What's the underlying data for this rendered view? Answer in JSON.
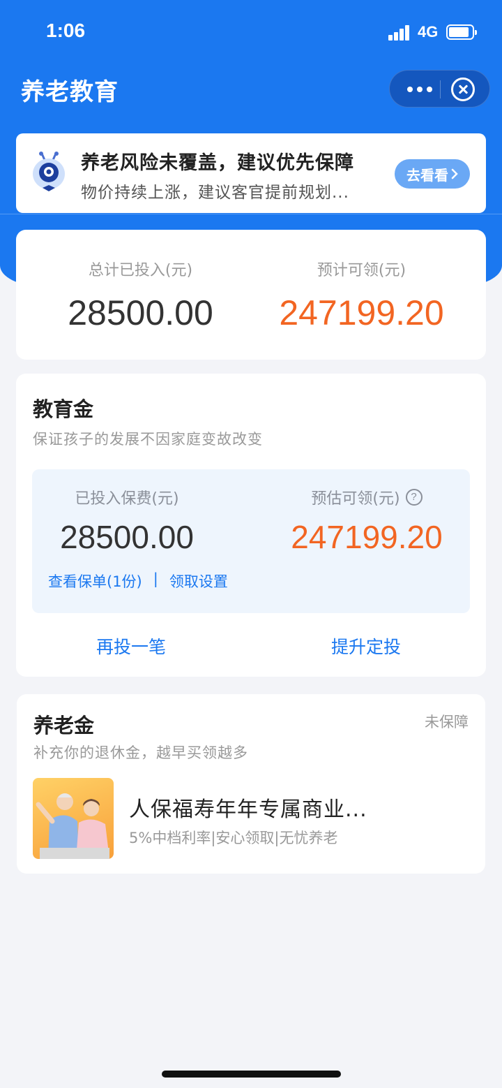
{
  "status_bar": {
    "time": "1:06",
    "network": "4G"
  },
  "nav": {
    "title": "养老教育"
  },
  "banner": {
    "title": "养老风险未覆盖，建议优先保障",
    "subtitle": "物价持续上涨，建议客官提前规划...",
    "button": "去看看"
  },
  "summary": {
    "invested_label": "总计已投入(元)",
    "invested_value": "28500.00",
    "expected_label": "预计可领(元)",
    "expected_value": "247199.20"
  },
  "education": {
    "title": "教育金",
    "subtitle": "保证孩子的发展不因家庭变故改变",
    "paid_label": "已投入保费(元)",
    "paid_value": "28500.00",
    "estimate_label": "预估可领(元)",
    "estimate_value": "247199.20",
    "link_policy": "查看保单(1份)",
    "link_separator": "|",
    "link_settings": "领取设置",
    "action_invest_again": "再投一笔",
    "action_increase": "提升定投"
  },
  "pension": {
    "title": "养老金",
    "status": "未保障",
    "subtitle": "补充你的退休金，越早买领越多",
    "product_title": "人保福寿年年专属商业...",
    "product_subtitle": "5%中档利率|安心领取|无忧养老"
  },
  "colors": {
    "primary_blue": "#1b78f0",
    "accent_orange": "#f26522",
    "background": "#f3f4f8"
  }
}
